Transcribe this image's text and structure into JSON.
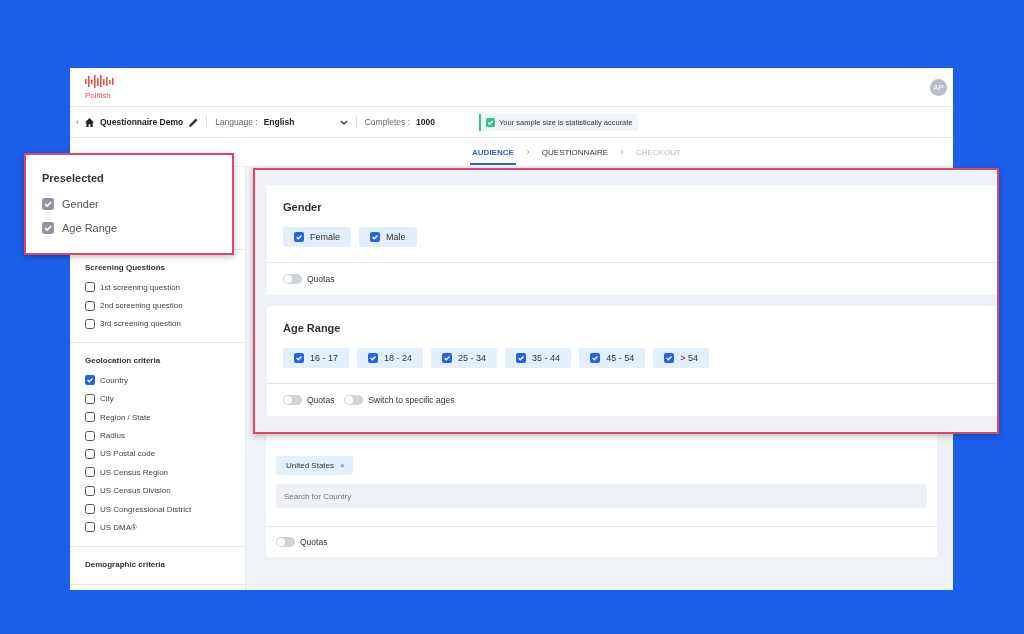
{
  "header": {
    "logo_text": "Pollfish",
    "avatar": "AP"
  },
  "toolbar": {
    "back": "‹",
    "title": "Questionnaire Demo",
    "language_label": "Language :",
    "language": "English",
    "completes_label": "Completes :",
    "completes": "1000",
    "status": "Your sample size is statistically accurate"
  },
  "steps": [
    {
      "label": "AUDIENCE",
      "selected": true,
      "disabled": false
    },
    {
      "label": "QUESTIONNAIRE",
      "selected": false,
      "disabled": false
    },
    {
      "label": "CHECKOUT",
      "selected": false,
      "disabled": true
    }
  ],
  "sidebar": {
    "sections": [
      {
        "title": "Screening Questions",
        "items": [
          {
            "label": "1st screening question",
            "checked": false
          },
          {
            "label": "2nd screening question",
            "checked": false
          },
          {
            "label": "3rd screening question",
            "checked": false
          }
        ]
      },
      {
        "title": "Geolocation criteria",
        "items": [
          {
            "label": "Country",
            "checked": true
          },
          {
            "label": "City",
            "checked": false
          },
          {
            "label": "Region / State",
            "checked": false
          },
          {
            "label": "Radius",
            "checked": false
          },
          {
            "label": "US Postal code",
            "checked": false
          },
          {
            "label": "US Census Region",
            "checked": false
          },
          {
            "label": "US Census Division",
            "checked": false
          },
          {
            "label": "US Congressional District",
            "checked": false
          },
          {
            "label": "US DMA®",
            "checked": false
          }
        ]
      },
      {
        "title": "Demographic criteria"
      }
    ]
  },
  "country_card": {
    "chips": [
      {
        "label": "United States",
        "remove": "×"
      }
    ],
    "search": {
      "placeholder": "Search for Country"
    },
    "toggles": [
      {
        "label": "Quotas",
        "on": false
      }
    ]
  },
  "preselected": {
    "title": "Preselected",
    "items": [
      {
        "label": "Gender",
        "checked": true,
        "disabled": true
      },
      {
        "label": "Age Range",
        "checked": true,
        "disabled": true
      }
    ]
  },
  "criteria": [
    {
      "title": "Gender",
      "options": [
        {
          "label": "Female",
          "checked": true
        },
        {
          "label": "Male",
          "checked": true
        }
      ],
      "toggles": [
        {
          "label": "Quotas",
          "on": false
        }
      ]
    },
    {
      "title": "Age Range",
      "options": [
        {
          "label": "16 - 17",
          "checked": true
        },
        {
          "label": "18 - 24",
          "checked": true
        },
        {
          "label": "25 - 34",
          "checked": true
        },
        {
          "label": "35 - 44",
          "checked": true
        },
        {
          "label": "45 - 54",
          "checked": true
        },
        {
          "label": "> 54",
          "checked": true
        }
      ],
      "toggles": [
        {
          "label": "Quotas",
          "on": false
        },
        {
          "label": "Switch to specific ages",
          "on": false
        }
      ]
    }
  ]
}
